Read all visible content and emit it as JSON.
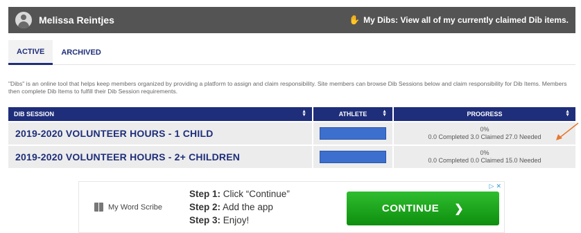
{
  "header": {
    "user_name": "Melissa Reintjes",
    "my_dibs_label": "My Dibs: View all of my currently claimed Dib items."
  },
  "tabs": [
    {
      "label": "ACTIVE",
      "active": true
    },
    {
      "label": "ARCHIVED",
      "active": false
    }
  ],
  "description": "\"Dibs\" is an online tool that helps keep members organized by providing a platform to assign and claim responsibility. Site members can browse Dib Sessions below and claim responsibility for Dib Items. Members then complete Dib Items to fulfill their Dib Session requirements.",
  "table": {
    "columns": [
      "DIB SESSION",
      "ATHLETE",
      "PROGRESS"
    ],
    "rows": [
      {
        "session": "2019-2020 VOLUNTEER HOURS - 1 CHILD",
        "progress_pct": "0%",
        "progress_detail": "0.0 Completed 3.0 Claimed 27.0 Needed"
      },
      {
        "session": "2019-2020 VOLUNTEER HOURS - 2+ CHILDREN",
        "progress_pct": "0%",
        "progress_detail": "0.0 Completed 0.0 Claimed 15.0 Needed"
      }
    ]
  },
  "ad": {
    "brand": "My Word Scribe",
    "steps": [
      {
        "label": "Step 1:",
        "text": "Click “Continue”"
      },
      {
        "label": "Step 2:",
        "text": "Add the app"
      },
      {
        "label": "Step 3:",
        "text": "Enjoy!"
      }
    ],
    "cta": "CONTINUE"
  },
  "colors": {
    "header_bg": "#545454",
    "brand_navy": "#1f2e7a",
    "athlete_select": "#3d6fcf",
    "cta_green": "#1aa31a",
    "annotation_arrow": "#e8772e"
  }
}
